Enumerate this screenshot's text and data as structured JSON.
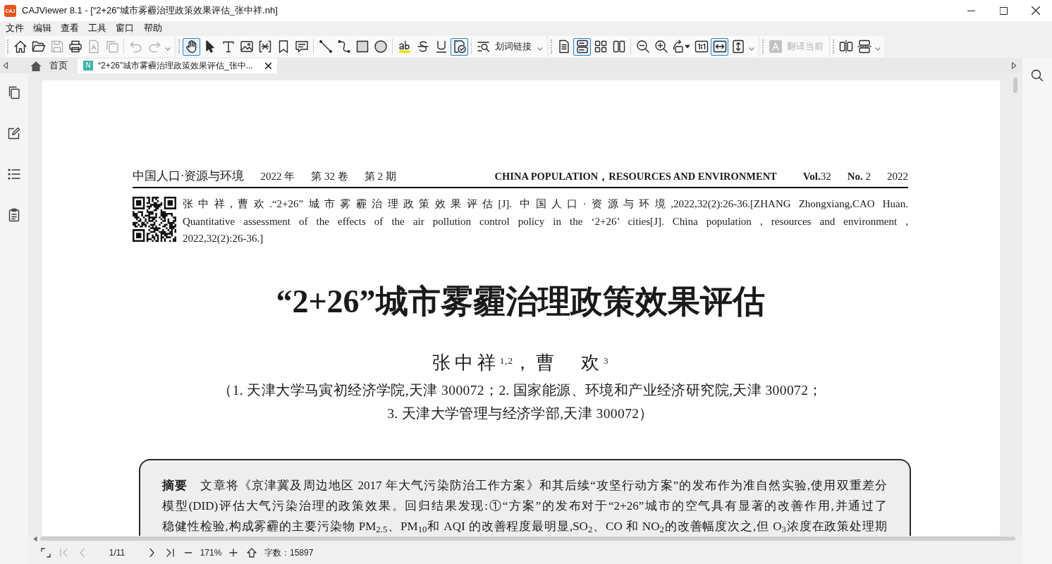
{
  "window": {
    "logo": "CAJ",
    "title": "CAJViewer 8.1 - [“2+26”城市雾霾治理政策效果评估_张中祥.nh]"
  },
  "menu": [
    "文件",
    "编辑",
    "查看",
    "工具",
    "窗口",
    "帮助"
  ],
  "toolbars": [
    {
      "menu": true,
      "sections": [
        {
          "items": [
            {
              "kind": "icon",
              "selected": false,
              "disabled": false
            },
            {
              "kind": "icon",
              "selected": false,
              "disabled": false
            },
            {
              "kind": "icon",
              "selected": false,
              "disabled": true
            },
            {
              "kind": "icon",
              "selected": false,
              "disabled": false
            },
            {
              "kind": "icon",
              "selected": false,
              "disabled": true
            },
            {
              "kind": "icon",
              "selected": false,
              "disabled": true
            }
          ]
        },
        {
          "items": [
            {
              "kind": "icon",
              "selected": false,
              "disabled": true
            },
            {
              "kind": "icon",
              "selected": false,
              "disabled": true
            }
          ]
        }
      ]
    },
    {
      "menu": true,
      "sections": [
        {
          "items": [
            {
              "kind": "icon",
              "selected": true,
              "disabled": false
            },
            {
              "kind": "icon",
              "selected": false,
              "disabled": false
            },
            {
              "kind": "icon",
              "selected": false,
              "disabled": false
            },
            {
              "kind": "icon",
              "selected": false,
              "disabled": false
            },
            {
              "kind": "icon",
              "selected": false,
              "disabled": false
            },
            {
              "kind": "icon",
              "selected": false,
              "disabled": false
            },
            {
              "kind": "icon",
              "selected": false,
              "disabled": false
            }
          ]
        },
        {
          "items": [
            {
              "kind": "icon",
              "selected": false,
              "disabled": false
            },
            {
              "kind": "icon",
              "selected": false,
              "disabled": false
            },
            {
              "kind": "icon",
              "selected": false,
              "disabled": false
            },
            {
              "kind": "icon",
              "selected": false,
              "disabled": false
            }
          ]
        },
        {
          "items": [
            {
              "kind": "icon",
              "selected": false,
              "disabled": false
            },
            {
              "kind": "icon",
              "selected": false,
              "disabled": false
            },
            {
              "kind": "icon",
              "selected": false,
              "disabled": false
            },
            {
              "kind": "icon",
              "selected": true,
              "disabled": false
            }
          ]
        },
        {
          "items": [
            {
              "kind": "labeled",
              "label": "划词链接",
              "selected": false,
              "disabled": false
            }
          ]
        }
      ]
    },
    {
      "menu": true,
      "sections": [
        {
          "items": [
            {
              "kind": "icon",
              "selected": false,
              "disabled": false
            },
            {
              "kind": "icon",
              "selected": true,
              "disabled": false
            },
            {
              "kind": "icon",
              "selected": false,
              "disabled": false
            },
            {
              "kind": "icon",
              "selected": false,
              "disabled": false
            }
          ]
        },
        {
          "items": [
            {
              "kind": "icon",
              "selected": false,
              "disabled": false
            },
            {
              "kind": "icon",
              "selected": false,
              "disabled": false
            },
            {
              "kind": "icon",
              "selected": false,
              "disabled": false
            },
            {
              "kind": "icon",
              "selected": false,
              "disabled": false
            },
            {
              "kind": "icon",
              "selected": true,
              "disabled": false
            },
            {
              "kind": "icon",
              "selected": false,
              "disabled": false
            }
          ]
        }
      ]
    },
    {
      "menu": false,
      "sections": [
        {
          "items": [
            {
              "kind": "labeled",
              "label": "翻译当前",
              "selected": false,
              "disabled": true
            }
          ]
        }
      ]
    },
    {
      "menu": true,
      "sections": [
        {
          "items": [
            {
              "kind": "icon",
              "selected": false,
              "disabled": false
            },
            {
              "kind": "icon",
              "selected": false,
              "disabled": false
            }
          ]
        }
      ]
    }
  ],
  "tabs": [
    {
      "kind": "home",
      "label": "首页",
      "selected": false,
      "closable": false
    },
    {
      "kind": "document",
      "badge": "N",
      "label": "“2+26”城市雾霾治理政策效果评估_张中...",
      "selected": true,
      "closable": true
    }
  ],
  "document": {
    "running_head": {
      "journal_cn": "中国人口·资源与环境",
      "year": "2022 年",
      "volume": "第 32 卷",
      "issue": "第 2 期",
      "journal_en": "CHINA POPULATION，RESOURCES AND ENVIRONMENT",
      "vol": "**Vol.**32",
      "no": "**No.** 2",
      "year_en": "2022"
    },
    "citation": {
      "lines": [
        "张中祥,曹欢.“2+26”城市雾霾治理政策效果评估[J]. 中国人口·资源与环境,2022,32(2):26-36.[ZHANG Zhongxiang,CAO Huan.",
        "Quantitative assessment of the effects of the air pollution control policy in the ‘2+26’ cities[J]. China population , resources and environment ,",
        "2022,32(2):26-36.]"
      ]
    },
    "title": "“2+26”城市雾霾治理政策效果评估",
    "authors": "张中祥$^{1,2}$，曹　欢$^{3}$",
    "affiliations": {
      "lines": [
        "（1. 天津大学马寅初经济学院,天津 300072；2. 国家能源、环境和产业经济研究院,天津 300072；",
        "3. 天津大学管理与经济学部,天津 300072）"
      ]
    },
    "abstract": {
      "lines": [
        "**摘要**　文章将《京津冀及周边地区 2017 年大气污染防治工作方案》和其后续“攻坚行动方案”的发布作为准自然实验,使用双重差分",
        "模型(DID)评估大气污染治理的政策效果。回归结果发现:①“方案”的发布对于“2+26”城市的空气具有显著的改善作用,并通过了",
        "稳健性检验,构成雾霾的主要污染物 PM$_{2.5}$、PM$_{10}$和 AQI 的改善程度最明显,SO$_{2}$、CO 和 NO$_{2}$的改善幅度次之,但 O$_{3}$浓度在政策处理期"
      ]
    }
  },
  "status_bar": {
    "back_buttons": [
      {
        "disabled": true
      },
      {
        "disabled": true
      }
    ],
    "page": "1/11",
    "forward_buttons": [
      {
        "disabled": false
      },
      {
        "disabled": false
      }
    ],
    "zoom": "171%",
    "word_count": "字数：15897"
  }
}
